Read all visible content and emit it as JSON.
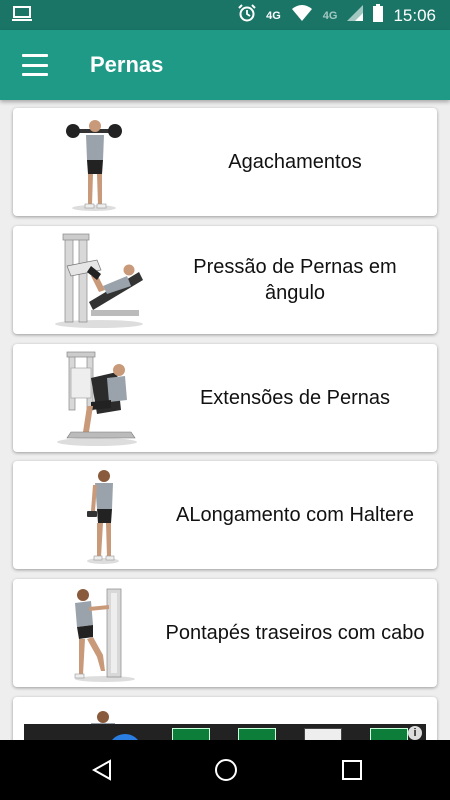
{
  "status_bar": {
    "network": "4G",
    "network2": "4G",
    "time": "15:06",
    "icons": [
      "laptop-icon",
      "alarm-icon",
      "signal-icon",
      "wifi-icon",
      "battery-icon"
    ]
  },
  "toolbar": {
    "title": "Pernas",
    "menu_icon": "hamburger-menu-icon"
  },
  "exercises": [
    {
      "name": "Agachamentos",
      "image": "squat-figure"
    },
    {
      "name": "Pressão de Pernas em ângulo",
      "image": "leg-press-figure"
    },
    {
      "name": "Extensões de Pernas",
      "image": "leg-extension-figure"
    },
    {
      "name": "ALongamento com Haltere",
      "image": "dumbbell-stretch-figure"
    },
    {
      "name": "Pontapés traseiros com cabo",
      "image": "cable-kickback-figure"
    },
    {
      "name": "",
      "image": "partial-figure"
    }
  ],
  "ad": {
    "info_label": "i"
  },
  "colors": {
    "toolbar": "#1f9a86",
    "status_bar": "#1a7567",
    "card": "#ffffff",
    "background": "#eeeeee"
  }
}
